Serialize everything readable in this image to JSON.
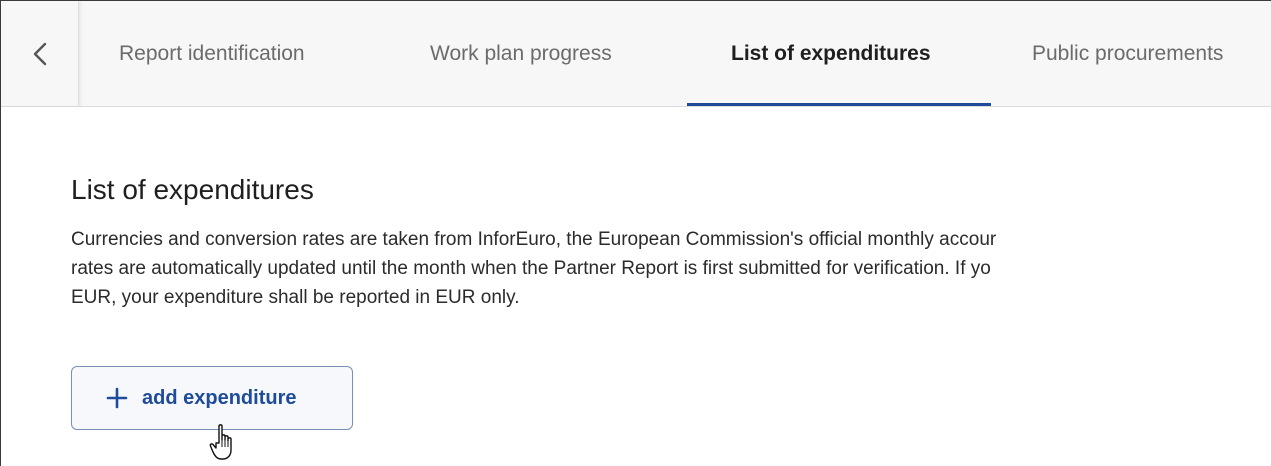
{
  "tabs": [
    {
      "label": "Report identification",
      "active": false
    },
    {
      "label": "Work plan progress",
      "active": false
    },
    {
      "label": "List of expenditures",
      "active": true
    },
    {
      "label": "Public procurements",
      "active": false
    }
  ],
  "main": {
    "title": "List of expenditures",
    "description_lines": [
      "Currencies and conversion rates are taken from InforEuro, the European Commission's official monthly accour",
      "rates are automatically updated until the month when the Partner Report is first submitted for verification. If yo",
      "EUR, your expenditure shall be reported in EUR only."
    ],
    "add_button_label": "add expenditure"
  },
  "icons": {
    "back": "chevron-left-icon",
    "add": "plus-icon",
    "cursor": "hand-pointer-icon"
  },
  "colors": {
    "accent": "#1e4b9a",
    "tab_inactive": "#6b6b6b",
    "tabbar_bg": "#f7f7f7"
  }
}
